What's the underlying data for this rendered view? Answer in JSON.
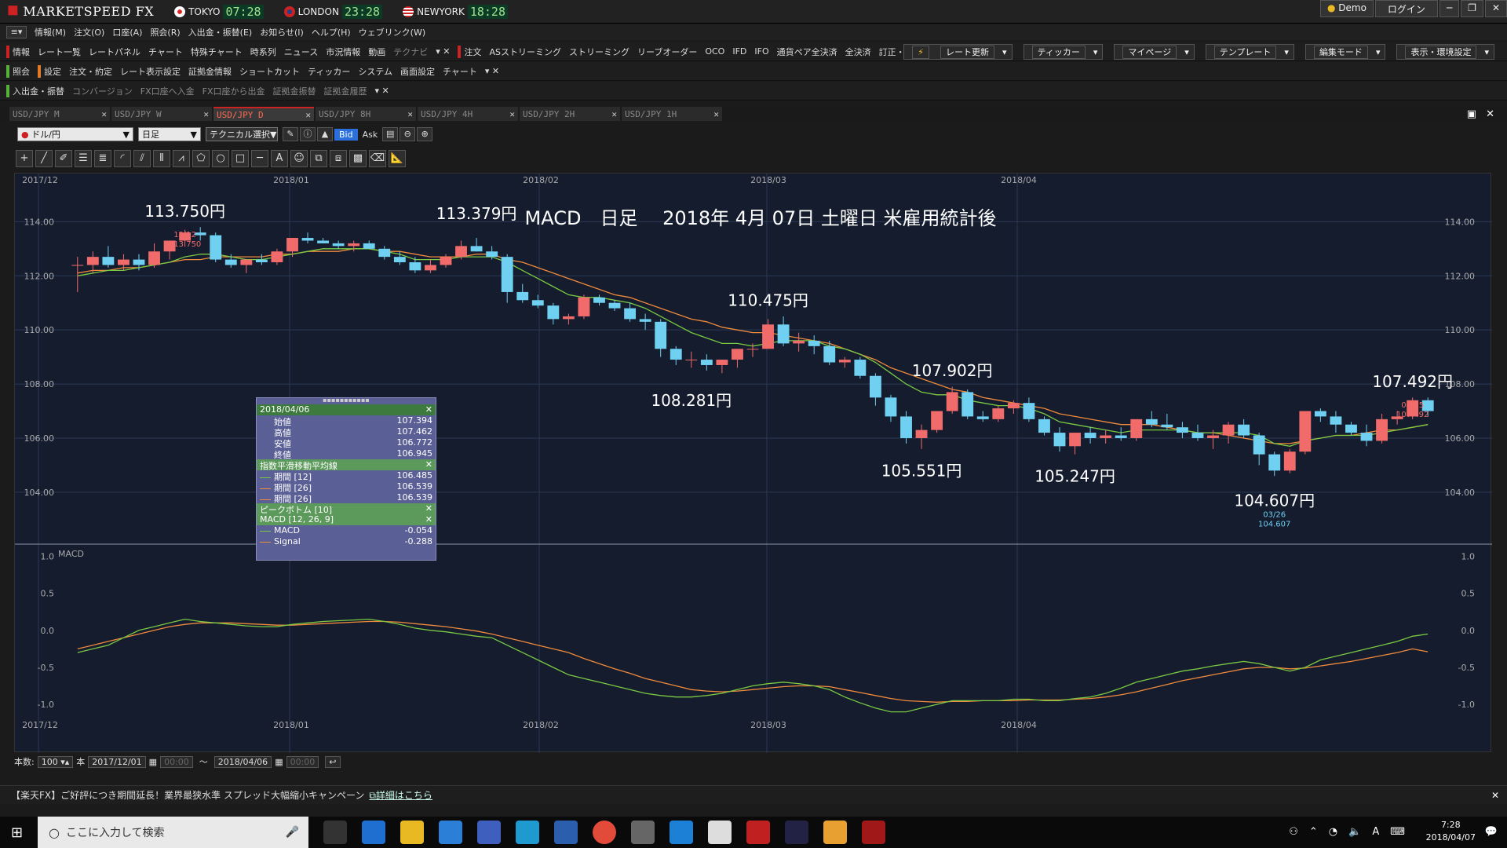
{
  "app": {
    "name": "MARKETSPEED FX",
    "clocks": [
      {
        "city": "TOKYO",
        "time": "07:28"
      },
      {
        "city": "LONDON",
        "time": "23:28"
      },
      {
        "city": "NEWYORK",
        "time": "18:28"
      }
    ],
    "window_buttons": [
      "Demo",
      "ログイン"
    ]
  },
  "menubar": [
    "情報(M)",
    "注文(O)",
    "口座(A)",
    "照会(R)",
    "入出金・振替(E)",
    "お知らせ(I)",
    "ヘルプ(H)",
    "ウェブリンク(W)"
  ],
  "toolbar1": {
    "section1": "情報",
    "items1": [
      "レート一覧",
      "レートパネル",
      "チャート",
      "特殊チャート",
      "時系列",
      "ニュース",
      "市況情報",
      "動画",
      "テクナビ"
    ],
    "section2": "注文",
    "items2": [
      "ASストリーミング",
      "ストリーミング",
      "リーブオーダー",
      "OCO",
      "IFD",
      "IFO",
      "通貨ペア全決済",
      "全決済",
      "訂正・取消"
    ],
    "right": [
      "レート更新",
      "ティッカー",
      "マイページ",
      "テンプレート",
      "編集モード",
      "表示・環境設定"
    ]
  },
  "toolbar2": {
    "section1": "照会",
    "section2": "設定",
    "items": [
      "注文・約定",
      "レート表示設定",
      "証拠金情報",
      "ショートカット",
      "ティッカー",
      "システム",
      "画面設定",
      "チャート"
    ]
  },
  "toolbar3": {
    "section": "入出金・振替",
    "items": [
      "コンバージョン",
      "FX口座へ入金",
      "FX口座から出金",
      "証拠金振替",
      "証拠金履歴"
    ]
  },
  "tabs": [
    {
      "label": "USD/JPY M",
      "active": false
    },
    {
      "label": "USD/JPY W",
      "active": false
    },
    {
      "label": "USD/JPY D",
      "active": true
    },
    {
      "label": "USD/JPY 8H",
      "active": false
    },
    {
      "label": "USD/JPY 4H",
      "active": false
    },
    {
      "label": "USD/JPY 2H",
      "active": false
    },
    {
      "label": "USD/JPY 1H",
      "active": false
    }
  ],
  "chart_toolbar": {
    "pair": "ドル/円",
    "period": "日足",
    "technical": "テクニカル選択",
    "bid": "Bid",
    "ask": "Ask"
  },
  "ohlc": {
    "date": "2018/04/06",
    "rows": [
      {
        "label": "始値",
        "value": "107.394"
      },
      {
        "label": "高値",
        "value": "107.462"
      },
      {
        "label": "安値",
        "value": "106.772"
      },
      {
        "label": "終値",
        "value": "106.945"
      }
    ],
    "ema_title": "指数平滑移動平均線",
    "ema": [
      {
        "label": "期間 [12]",
        "value": "106.485",
        "color": "#7ac943"
      },
      {
        "label": "期間 [26]",
        "value": "106.539",
        "color": "#f08a3c"
      },
      {
        "label": "期間 [26]",
        "value": "106.539",
        "color": "#f08a3c"
      }
    ],
    "peak_title": "ピークボトム [10]",
    "macd_title": "MACD [12, 26, 9]",
    "macd": [
      {
        "label": "MACD",
        "value": "-0.054",
        "color": "#7ac943"
      },
      {
        "label": "Signal",
        "value": "-0.288",
        "color": "#f08a3c"
      }
    ]
  },
  "status": {
    "count_label": "本数:",
    "count": "100",
    "unit": "本",
    "from": "2017/12/01",
    "from_time": "00:00",
    "to": "2018/04/06",
    "to_time": "00:00"
  },
  "banner": {
    "text": "【楽天FX】ご好評につき期間延長！業界最狭水準 スプレッド大幅縮小キャンペーン",
    "link": "詳細はこちら"
  },
  "taskbar": {
    "search_placeholder": "ここに入力して検索",
    "time": "7:28",
    "date": "2018/04/07"
  },
  "chart_data": {
    "type": "candlestick",
    "title": "MACD　日足　 2018年 4月 07日 土曜日 米雇用統計後",
    "x_labels": [
      "2017/12",
      "2018/01",
      "2018/02",
      "2018/03",
      "2018/04"
    ],
    "y_ticks": [
      "114.00",
      "112.00",
      "110.00",
      "108.00",
      "106.00",
      "104.00"
    ],
    "ylim": [
      103.3,
      115.2
    ],
    "candles": [
      [
        112.4,
        112.7,
        111.4,
        112.4
      ],
      [
        112.4,
        112.9,
        112.1,
        112.7
      ],
      [
        112.7,
        113.1,
        112.3,
        112.4
      ],
      [
        112.4,
        112.8,
        112.2,
        112.6
      ],
      [
        112.6,
        112.8,
        112.2,
        112.4
      ],
      [
        112.4,
        113.2,
        112.3,
        112.9
      ],
      [
        112.9,
        113.3,
        112.6,
        113.3
      ],
      [
        113.3,
        113.7,
        113.1,
        113.6
      ],
      [
        113.6,
        113.8,
        113.3,
        113.5
      ],
      [
        113.5,
        113.6,
        112.5,
        112.6
      ],
      [
        112.6,
        112.8,
        112.3,
        112.4
      ],
      [
        112.4,
        112.6,
        112.1,
        112.6
      ],
      [
        112.6,
        112.8,
        112.4,
        112.5
      ],
      [
        112.5,
        113.0,
        112.4,
        112.9
      ],
      [
        112.9,
        113.4,
        112.7,
        113.4
      ],
      [
        113.4,
        113.6,
        113.2,
        113.3
      ],
      [
        113.3,
        113.4,
        113.2,
        113.2
      ],
      [
        113.2,
        113.3,
        113.0,
        113.1
      ],
      [
        113.1,
        113.3,
        112.9,
        113.2
      ],
      [
        113.2,
        113.3,
        113.0,
        113.0
      ],
      [
        113.0,
        113.1,
        112.6,
        112.7
      ],
      [
        112.7,
        112.9,
        112.4,
        112.5
      ],
      [
        112.5,
        112.7,
        112.1,
        112.2
      ],
      [
        112.2,
        112.6,
        112.1,
        112.4
      ],
      [
        112.4,
        112.8,
        112.3,
        112.7
      ],
      [
        112.7,
        113.3,
        112.6,
        113.1
      ],
      [
        113.1,
        113.4,
        112.9,
        112.9
      ],
      [
        112.9,
        113.1,
        112.6,
        112.7
      ],
      [
        112.7,
        112.8,
        111.0,
        111.4
      ],
      [
        111.4,
        111.7,
        111.0,
        111.1
      ],
      [
        111.1,
        111.3,
        110.8,
        110.9
      ],
      [
        110.9,
        111.0,
        110.2,
        110.4
      ],
      [
        110.4,
        110.6,
        110.2,
        110.5
      ],
      [
        110.5,
        111.3,
        110.4,
        111.2
      ],
      [
        111.2,
        111.3,
        110.9,
        111.0
      ],
      [
        111.0,
        111.1,
        110.7,
        110.8
      ],
      [
        110.8,
        111.0,
        110.3,
        110.4
      ],
      [
        110.4,
        110.6,
        110.0,
        110.3
      ],
      [
        110.3,
        110.4,
        109.0,
        109.3
      ],
      [
        109.3,
        109.4,
        108.7,
        108.9
      ],
      [
        108.9,
        109.2,
        108.6,
        108.9
      ],
      [
        108.9,
        109.1,
        108.5,
        108.7
      ],
      [
        108.7,
        108.9,
        108.4,
        108.9
      ],
      [
        108.9,
        109.2,
        108.6,
        109.3
      ],
      [
        109.3,
        109.5,
        109.0,
        109.3
      ],
      [
        109.3,
        110.4,
        109.3,
        110.2
      ],
      [
        110.2,
        110.5,
        109.4,
        109.5
      ],
      [
        109.5,
        109.9,
        109.2,
        109.6
      ],
      [
        109.6,
        109.8,
        109.1,
        109.4
      ],
      [
        109.4,
        109.6,
        108.7,
        108.8
      ],
      [
        108.8,
        109.0,
        108.6,
        108.9
      ],
      [
        108.9,
        109.0,
        108.2,
        108.3
      ],
      [
        108.3,
        108.4,
        107.2,
        107.5
      ],
      [
        107.5,
        107.6,
        106.6,
        106.8
      ],
      [
        106.8,
        107.0,
        105.8,
        106.0
      ],
      [
        106.0,
        106.5,
        105.6,
        106.3
      ],
      [
        106.3,
        107.0,
        106.2,
        107.0
      ],
      [
        107.0,
        107.9,
        106.9,
        107.7
      ],
      [
        107.7,
        107.8,
        106.7,
        106.8
      ],
      [
        106.8,
        107.0,
        106.6,
        106.7
      ],
      [
        106.7,
        107.2,
        106.6,
        107.1
      ],
      [
        107.1,
        107.4,
        106.9,
        107.3
      ],
      [
        107.3,
        107.5,
        106.6,
        106.7
      ],
      [
        106.7,
        106.8,
        106.1,
        106.2
      ],
      [
        106.2,
        106.4,
        105.5,
        105.7
      ],
      [
        105.7,
        106.2,
        105.4,
        106.2
      ],
      [
        106.2,
        106.4,
        105.8,
        106.0
      ],
      [
        106.0,
        106.3,
        105.8,
        106.1
      ],
      [
        106.1,
        106.4,
        105.9,
        106.0
      ],
      [
        106.0,
        106.5,
        105.9,
        106.7
      ],
      [
        106.7,
        107.0,
        106.4,
        106.5
      ],
      [
        106.5,
        106.9,
        106.3,
        106.4
      ],
      [
        106.4,
        106.6,
        106.0,
        106.2
      ],
      [
        106.2,
        106.5,
        105.9,
        106.0
      ],
      [
        106.0,
        106.3,
        105.6,
        106.1
      ],
      [
        106.1,
        106.6,
        105.8,
        106.5
      ],
      [
        106.5,
        106.7,
        106.0,
        106.1
      ],
      [
        106.1,
        106.2,
        105.0,
        105.4
      ],
      [
        105.4,
        105.5,
        104.6,
        104.8
      ],
      [
        104.8,
        105.6,
        104.7,
        105.5
      ],
      [
        105.5,
        106.4,
        105.4,
        107.0
      ],
      [
        107.0,
        107.1,
        106.6,
        106.8
      ],
      [
        106.8,
        107.0,
        106.2,
        106.5
      ],
      [
        106.5,
        106.6,
        106.1,
        106.2
      ],
      [
        106.2,
        106.5,
        105.7,
        105.9
      ],
      [
        105.9,
        106.9,
        105.8,
        106.7
      ],
      [
        106.7,
        107.0,
        106.5,
        106.8
      ],
      [
        106.8,
        107.5,
        106.7,
        107.4
      ],
      [
        107.4,
        107.5,
        106.8,
        107.0
      ]
    ],
    "ema12": [
      112.0,
      112.1,
      112.2,
      112.2,
      112.3,
      112.4,
      112.5,
      112.7,
      112.8,
      112.8,
      112.7,
      112.6,
      112.6,
      112.7,
      112.8,
      112.9,
      113.0,
      113.0,
      113.0,
      113.0,
      112.9,
      112.8,
      112.6,
      112.6,
      112.6,
      112.7,
      112.7,
      112.7,
      112.5,
      112.2,
      111.9,
      111.6,
      111.3,
      111.2,
      111.2,
      111.1,
      111.0,
      110.8,
      110.5,
      110.2,
      109.9,
      109.7,
      109.5,
      109.5,
      109.4,
      109.5,
      109.6,
      109.6,
      109.6,
      109.4,
      109.3,
      109.1,
      108.8,
      108.4,
      108.0,
      107.7,
      107.6,
      107.6,
      107.4,
      107.3,
      107.2,
      107.2,
      107.1,
      106.9,
      106.6,
      106.5,
      106.4,
      106.3,
      106.2,
      106.3,
      106.3,
      106.3,
      106.3,
      106.2,
      106.2,
      106.2,
      106.2,
      106.1,
      105.8,
      105.7,
      105.9,
      106.0,
      106.1,
      106.1,
      106.1,
      106.2,
      106.3,
      106.4,
      106.5
    ],
    "ema26": [
      112.1,
      112.2,
      112.2,
      112.3,
      112.3,
      112.4,
      112.5,
      112.6,
      112.6,
      112.7,
      112.7,
      112.7,
      112.7,
      112.8,
      112.8,
      112.9,
      112.9,
      112.9,
      113.0,
      113.0,
      112.9,
      112.9,
      112.8,
      112.7,
      112.7,
      112.7,
      112.8,
      112.8,
      112.6,
      112.5,
      112.3,
      112.1,
      111.9,
      111.7,
      111.5,
      111.3,
      111.2,
      111.0,
      110.8,
      110.6,
      110.4,
      110.3,
      110.1,
      110.0,
      109.9,
      109.9,
      109.8,
      109.7,
      109.6,
      109.5,
      109.3,
      109.1,
      108.9,
      108.6,
      108.4,
      108.2,
      108.0,
      107.8,
      107.7,
      107.5,
      107.4,
      107.3,
      107.2,
      107.1,
      106.9,
      106.8,
      106.7,
      106.6,
      106.5,
      106.5,
      106.5,
      106.4,
      106.3,
      106.2,
      106.2,
      106.1,
      106.0,
      105.9,
      105.8,
      105.8,
      105.9,
      106.0,
      106.1,
      106.1,
      106.2,
      106.3,
      106.3,
      106.4,
      106.5
    ],
    "annotations": [
      {
        "label": "113.750円",
        "i": 7,
        "price": 113.9,
        "pos": "above",
        "small_date": "12/12",
        "small_value": "113.750"
      },
      {
        "label": "113.379円",
        "i": 26,
        "price": 113.8,
        "pos": "above"
      },
      {
        "label": "110.475円",
        "i": 45,
        "price": 110.6,
        "pos": "above"
      },
      {
        "label": "108.281円",
        "i": 40,
        "price": 108.0,
        "pos": "below"
      },
      {
        "label": "107.902円",
        "i": 57,
        "price": 108.0,
        "pos": "above"
      },
      {
        "label": "105.551円",
        "i": 55,
        "price": 105.4,
        "pos": "below"
      },
      {
        "label": "105.247円",
        "i": 65,
        "price": 105.2,
        "pos": "below"
      },
      {
        "label": "104.607円",
        "i": 78,
        "price": 104.3,
        "pos": "below",
        "small_date": "03/26",
        "small_value": "104.607"
      },
      {
        "label": "107.492円",
        "i": 87,
        "price": 107.6,
        "pos": "above",
        "small_date": "04/05",
        "small_value": "107.492"
      }
    ],
    "macd_panel": {
      "title": "MACD",
      "y_ticks": [
        "1.0",
        "0.5",
        "0.0",
        "-0.5",
        "-1.0"
      ],
      "ylim": [
        -1.2,
        1.1
      ],
      "macd": [
        -0.3,
        -0.25,
        -0.2,
        -0.1,
        0.0,
        0.05,
        0.1,
        0.15,
        0.12,
        0.1,
        0.08,
        0.06,
        0.05,
        0.05,
        0.08,
        0.1,
        0.12,
        0.13,
        0.14,
        0.15,
        0.12,
        0.08,
        0.03,
        0.0,
        -0.02,
        -0.05,
        -0.08,
        -0.1,
        -0.2,
        -0.3,
        -0.4,
        -0.5,
        -0.6,
        -0.65,
        -0.7,
        -0.75,
        -0.8,
        -0.85,
        -0.88,
        -0.9,
        -0.9,
        -0.88,
        -0.85,
        -0.8,
        -0.75,
        -0.72,
        -0.7,
        -0.72,
        -0.75,
        -0.8,
        -0.9,
        -0.98,
        -1.05,
        -1.1,
        -1.1,
        -1.05,
        -1.0,
        -0.95,
        -0.95,
        -0.95,
        -0.95,
        -0.93,
        -0.93,
        -0.95,
        -0.95,
        -0.92,
        -0.9,
        -0.85,
        -0.78,
        -0.7,
        -0.65,
        -0.6,
        -0.55,
        -0.52,
        -0.48,
        -0.45,
        -0.42,
        -0.45,
        -0.5,
        -0.55,
        -0.5,
        -0.4,
        -0.35,
        -0.3,
        -0.25,
        -0.2,
        -0.15,
        -0.08,
        -0.05
      ],
      "signal": [
        -0.25,
        -0.2,
        -0.15,
        -0.1,
        -0.05,
        0.0,
        0.05,
        0.08,
        0.1,
        0.1,
        0.1,
        0.09,
        0.08,
        0.07,
        0.07,
        0.08,
        0.09,
        0.1,
        0.11,
        0.12,
        0.12,
        0.11,
        0.09,
        0.07,
        0.05,
        0.02,
        -0.01,
        -0.05,
        -0.1,
        -0.15,
        -0.2,
        -0.25,
        -0.3,
        -0.38,
        -0.45,
        -0.52,
        -0.58,
        -0.65,
        -0.7,
        -0.75,
        -0.8,
        -0.82,
        -0.83,
        -0.82,
        -0.8,
        -0.78,
        -0.76,
        -0.75,
        -0.75,
        -0.76,
        -0.8,
        -0.84,
        -0.88,
        -0.92,
        -0.95,
        -0.96,
        -0.97,
        -0.96,
        -0.96,
        -0.95,
        -0.95,
        -0.95,
        -0.94,
        -0.94,
        -0.94,
        -0.93,
        -0.92,
        -0.9,
        -0.87,
        -0.83,
        -0.78,
        -0.73,
        -0.68,
        -0.64,
        -0.6,
        -0.56,
        -0.52,
        -0.5,
        -0.5,
        -0.52,
        -0.51,
        -0.48,
        -0.45,
        -0.42,
        -0.38,
        -0.34,
        -0.3,
        -0.25,
        -0.29
      ]
    }
  }
}
